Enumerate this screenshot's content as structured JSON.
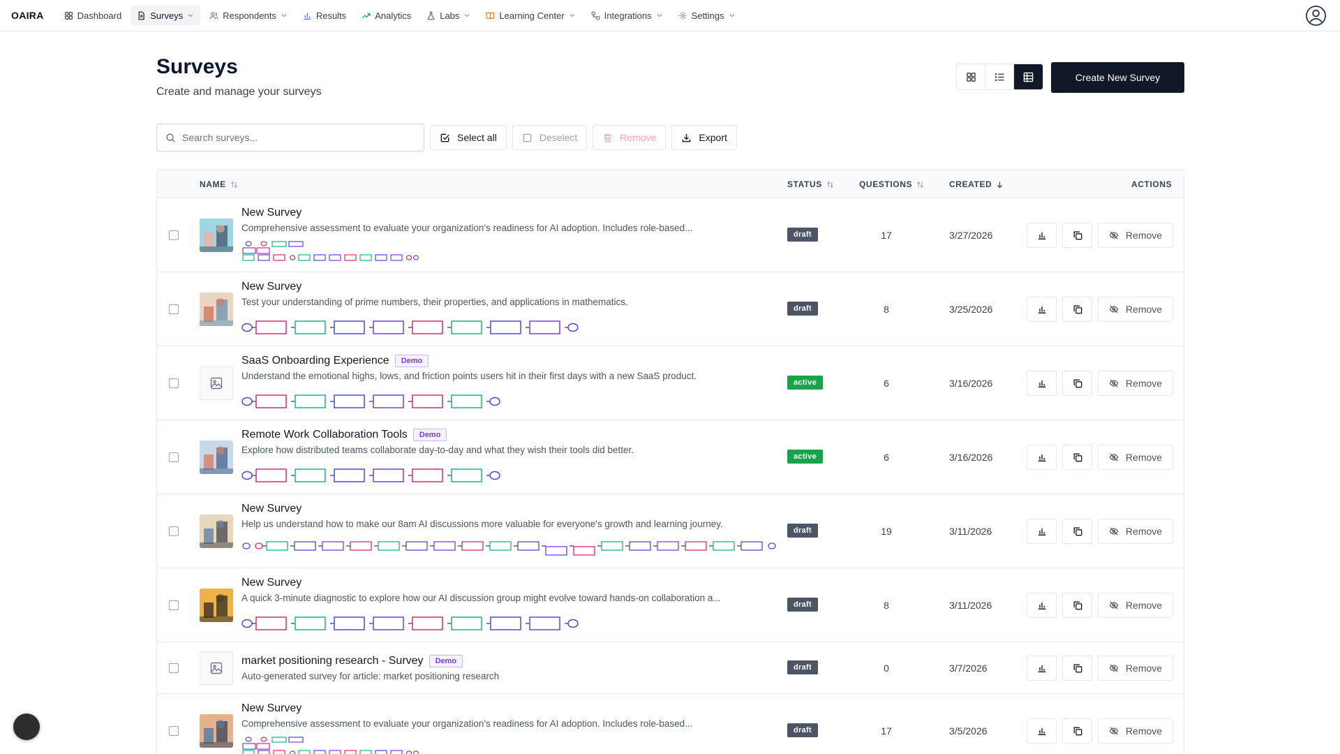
{
  "nav": {
    "brand": "OAIRA",
    "items": [
      {
        "label": "Dashboard",
        "icon": "grid-icon",
        "dropdown": false,
        "active": false
      },
      {
        "label": "Surveys",
        "icon": "document-icon",
        "dropdown": true,
        "active": true
      },
      {
        "label": "Respondents",
        "icon": "users-icon",
        "dropdown": true,
        "active": false
      },
      {
        "label": "Results",
        "icon": "bar-chart-icon",
        "dropdown": false,
        "active": false
      },
      {
        "label": "Analytics",
        "icon": "trending-icon",
        "dropdown": false,
        "active": false
      },
      {
        "label": "Labs",
        "icon": "flask-icon",
        "dropdown": true,
        "active": false
      },
      {
        "label": "Learning Center",
        "icon": "book-icon",
        "dropdown": true,
        "active": false
      },
      {
        "label": "Integrations",
        "icon": "workflow-icon",
        "dropdown": true,
        "active": false
      },
      {
        "label": "Settings",
        "icon": "gear-icon",
        "dropdown": true,
        "active": false
      }
    ]
  },
  "header": {
    "title": "Surveys",
    "subtitle": "Create and manage your surveys",
    "create_label": "Create New Survey"
  },
  "toolbar": {
    "search_placeholder": "Search surveys...",
    "select_all": "Select all",
    "deselect": "Deselect",
    "remove": "Remove",
    "export": "Export"
  },
  "table": {
    "columns": {
      "name": "NAME",
      "status": "STATUS",
      "questions": "QUESTIONS",
      "created": "CREATED",
      "actions": "ACTIONS"
    },
    "remove_label": "Remove",
    "rows": [
      {
        "title": "New Survey",
        "demo": "",
        "description": "Comprehensive assessment to evaluate your organization's readiness for AI adoption. Includes role-based...",
        "status": "draft",
        "questions": "17",
        "created": "3/27/2026"
      },
      {
        "title": "New Survey",
        "demo": "",
        "description": "Test your understanding of prime numbers, their properties, and applications in mathematics.",
        "status": "draft",
        "questions": "8",
        "created": "3/25/2026"
      },
      {
        "title": "SaaS Onboarding Experience",
        "demo": "Demo",
        "description": "Understand the emotional highs, lows, and friction points users hit in their first days with a new SaaS product.",
        "status": "active",
        "questions": "6",
        "created": "3/16/2026"
      },
      {
        "title": "Remote Work Collaboration Tools",
        "demo": "Demo",
        "description": "Explore how distributed teams collaborate day-to-day and what they wish their tools did better.",
        "status": "active",
        "questions": "6",
        "created": "3/16/2026"
      },
      {
        "title": "New Survey",
        "demo": "",
        "description": "Help us understand how to make our 8am AI discussions more valuable for everyone's growth and learning journey.",
        "status": "draft",
        "questions": "19",
        "created": "3/11/2026"
      },
      {
        "title": "New Survey",
        "demo": "",
        "description": "A quick 3-minute diagnostic to explore how our AI discussion group might evolve toward hands-on collaboration a...",
        "status": "draft",
        "questions": "8",
        "created": "3/11/2026"
      },
      {
        "title": "market positioning research - Survey",
        "demo": "Demo",
        "description": "Auto-generated survey for article: market positioning research",
        "status": "draft",
        "questions": "0",
        "created": "3/7/2026"
      },
      {
        "title": "New Survey",
        "demo": "",
        "description": "Comprehensive assessment to evaluate your organization's readiness for AI adoption. Includes role-based...",
        "status": "draft",
        "questions": "17",
        "created": "3/5/2026"
      }
    ]
  },
  "colors": {
    "primary": "#111827",
    "active_green": "#16a34a",
    "draft_gray": "#4b5563",
    "demo_purple": "#7c3aed",
    "flow_pink": "#db2777",
    "flow_green": "#10b981",
    "flow_purple": "#4f46e5"
  }
}
